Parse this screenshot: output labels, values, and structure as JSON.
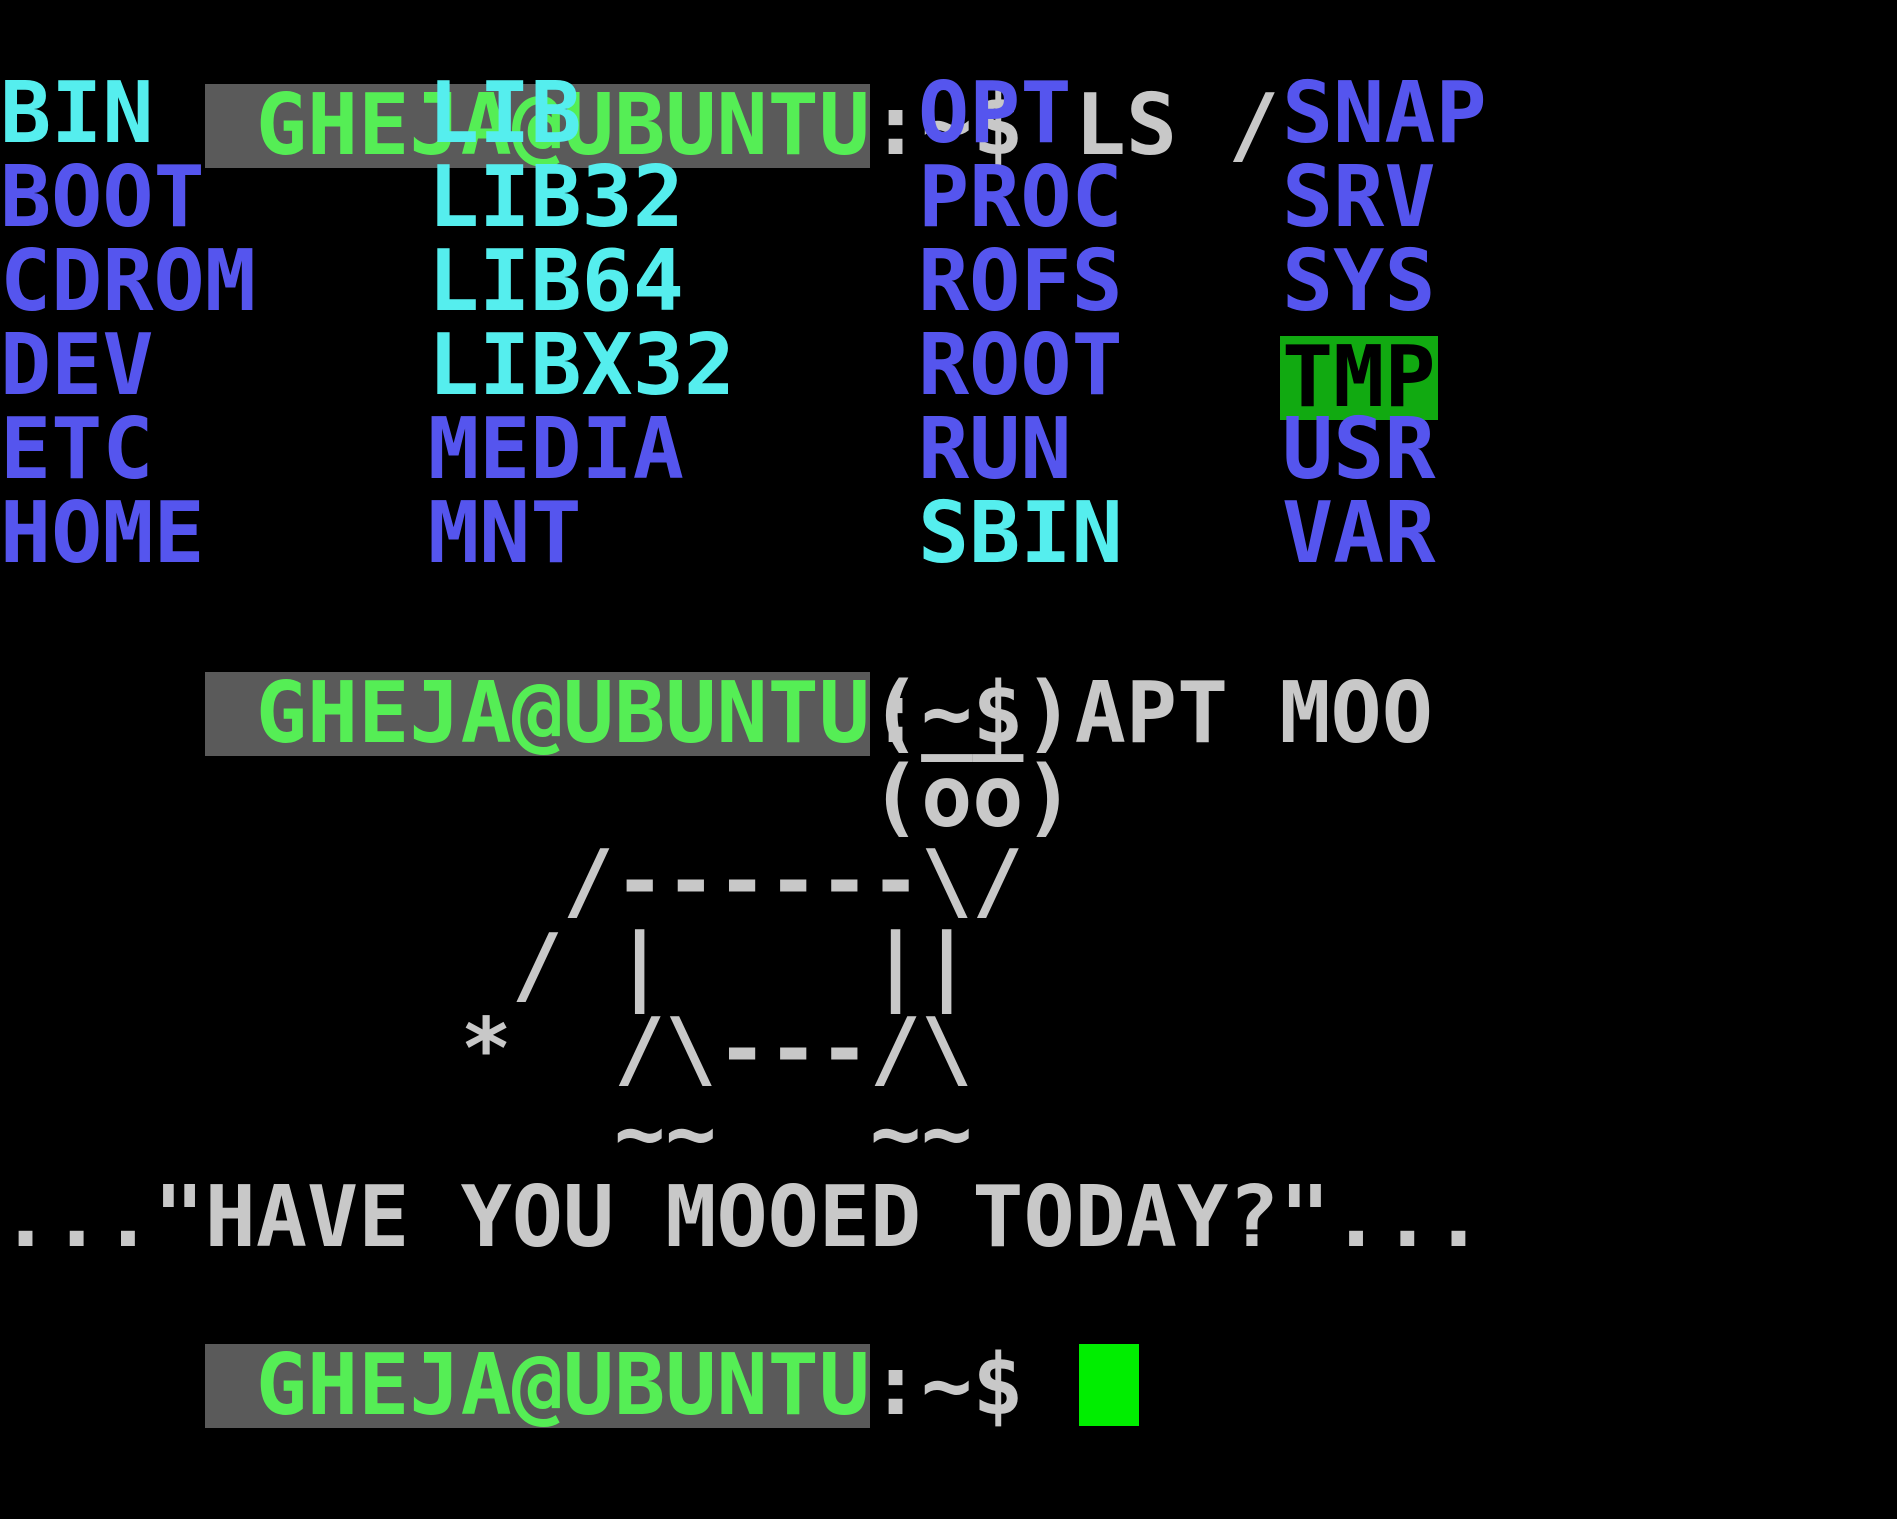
{
  "prompt": {
    "user": " GHEJA@UBUNTU",
    "path": ":~$ "
  },
  "commands": {
    "first": "LS /",
    "second": "APT MOO"
  },
  "listing": {
    "col1": [
      "BIN",
      "BOOT",
      "CDROM",
      "DEV",
      "ETC",
      "HOME"
    ],
    "col2": [
      "LIB",
      "LIB32",
      "LIB64",
      "LIBX32",
      "MEDIA",
      "MNT"
    ],
    "col3": [
      "OPT",
      "PROC",
      "ROFS",
      "ROOT",
      "RUN",
      "SBIN"
    ],
    "col4": [
      "SNAP",
      "SRV",
      "SYS",
      "TMP",
      "USR",
      "VAR"
    ]
  },
  "cow_art": [
    "                 (__)",
    "                 (oo)",
    "           /------\\/",
    "          / |    ||",
    "         *  /\\---/\\",
    "            ~~   ~~"
  ],
  "moo_message": "...\"HAVE YOU MOOED TODAY?\"...",
  "colors": {
    "background": "#000000",
    "prompt_user_fg": "#55ee55",
    "prompt_user_bg": "#5a5a5a",
    "text": "#c8c8c8",
    "dir_blue": "#5555ee",
    "dir_cyan": "#55eeee",
    "sticky_dir_bg": "#11aa11",
    "cursor": "#00ee00"
  }
}
